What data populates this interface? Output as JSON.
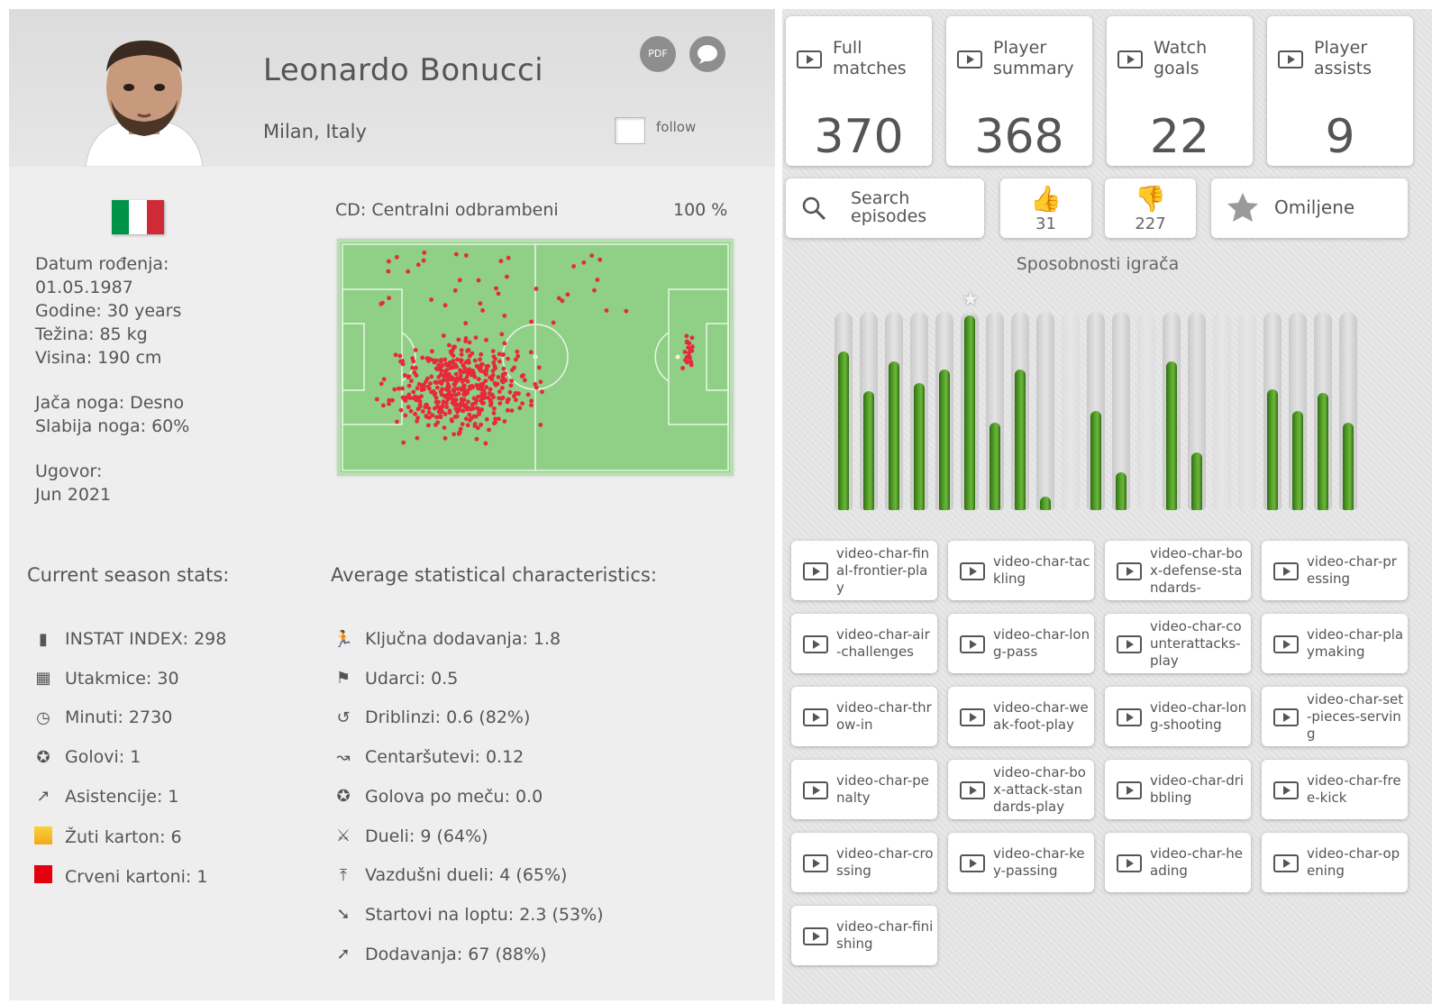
{
  "player": {
    "name": "Leonardo Bonucci",
    "club": "Milan, Italy",
    "pdf_label": "PDF",
    "follow_label": "follow"
  },
  "bio": {
    "birth_label": "Datum rođenja:",
    "birth_value": "01.05.1987",
    "age": "Godine: 30 years",
    "weight": "Težina: 85 kg",
    "height": "Visina: 190 cm",
    "strong_foot": "Jača noga: Desno",
    "weak_foot": "Slabija noga: 60%",
    "contract_label": "Ugovor:",
    "contract_value": "Jun 2021"
  },
  "position": {
    "label": "CD:  Centralni odbrambeni",
    "percent": "100 %"
  },
  "season_stats": {
    "title": "Current season stats:",
    "items": [
      {
        "text": "INSTAT INDEX: 298",
        "icon": "bar-chart-icon"
      },
      {
        "text": "Utakmice: 30",
        "icon": "calendar-icon"
      },
      {
        "text": "Minuti: 2730",
        "icon": "clock-icon"
      },
      {
        "text": "Golovi: 1",
        "icon": "ball-icon"
      },
      {
        "text": "Asistencije: 1",
        "icon": "assist-icon"
      },
      {
        "text": "Žuti karton: 6",
        "icon": "yellow-card-icon"
      },
      {
        "text": "Crveni kartoni: 1",
        "icon": "red-card-icon"
      }
    ]
  },
  "average_stats": {
    "title": "Average statistical characteristics:",
    "items": [
      {
        "text": "Ključna dodavanja: 1.8",
        "icon": "key-pass-icon"
      },
      {
        "text": "Udarci: 0.5",
        "icon": "shot-icon"
      },
      {
        "text": "Driblinzi: 0.6 (82%)",
        "icon": "dribble-icon"
      },
      {
        "text": "Centaršutevi: 0.12",
        "icon": "cross-icon"
      },
      {
        "text": "Golova po meču: 0.0",
        "icon": "ball-icon"
      },
      {
        "text": "Dueli: 9 (64%)",
        "icon": "duel-icon"
      },
      {
        "text": "Vazdušni dueli: 4 (65%)",
        "icon": "air-duel-icon"
      },
      {
        "text": "Startovi na loptu: 2.3 (53%)",
        "icon": "tackle-icon"
      },
      {
        "text": "Dodavanja: 67 (88%)",
        "icon": "pass-icon"
      }
    ]
  },
  "video_cards": [
    {
      "label": "Full\nmatches",
      "count": "370"
    },
    {
      "label": "Player\nsummary",
      "count": "368"
    },
    {
      "label": "Watch\ngoals",
      "count": "22"
    },
    {
      "label": "Player\nassists",
      "count": "9"
    }
  ],
  "tools": {
    "search_label": "Search\nepisodes",
    "likes": "31",
    "dislikes": "227",
    "favorites_label": "Omiljene"
  },
  "abilities": {
    "title": "Sposobnosti igrača",
    "levels": [
      0.8,
      0.6,
      0.75,
      0.64,
      0.71,
      0.98,
      0.44,
      0.71,
      0.07,
      0,
      0.5,
      0.19,
      0,
      0.75,
      0.29,
      0,
      0,
      0.61,
      0.5,
      0.59,
      0.44
    ],
    "starred_index": 5,
    "fill_color": "#4f9a26"
  },
  "video_chars": [
    "video-char-final-frontier-play",
    "video-char-tackling",
    "video-char-box-defense-standards-",
    "video-char-pressing",
    "video-char-air-challenges",
    "video-char-long-pass",
    "video-char-counterattacks-play",
    "video-char-playmaking",
    "video-char-throw-in",
    "video-char-weak-foot-play",
    "video-char-long-shooting",
    "video-char-set-pieces-serving",
    "video-char-penalty",
    "video-char-box-attack-standards-play",
    "video-char-dribbling",
    "video-char-free-kick",
    "video-char-crossing",
    "video-char-key-passing",
    "video-char-heading",
    "video-char-opening",
    "video-char-finishing"
  ],
  "colors": {
    "flag_green": "#009246",
    "flag_white": "#ffffff",
    "flag_red": "#ce2b37",
    "pitch": "#8fcf86",
    "heat_dots": "#e8283c"
  }
}
